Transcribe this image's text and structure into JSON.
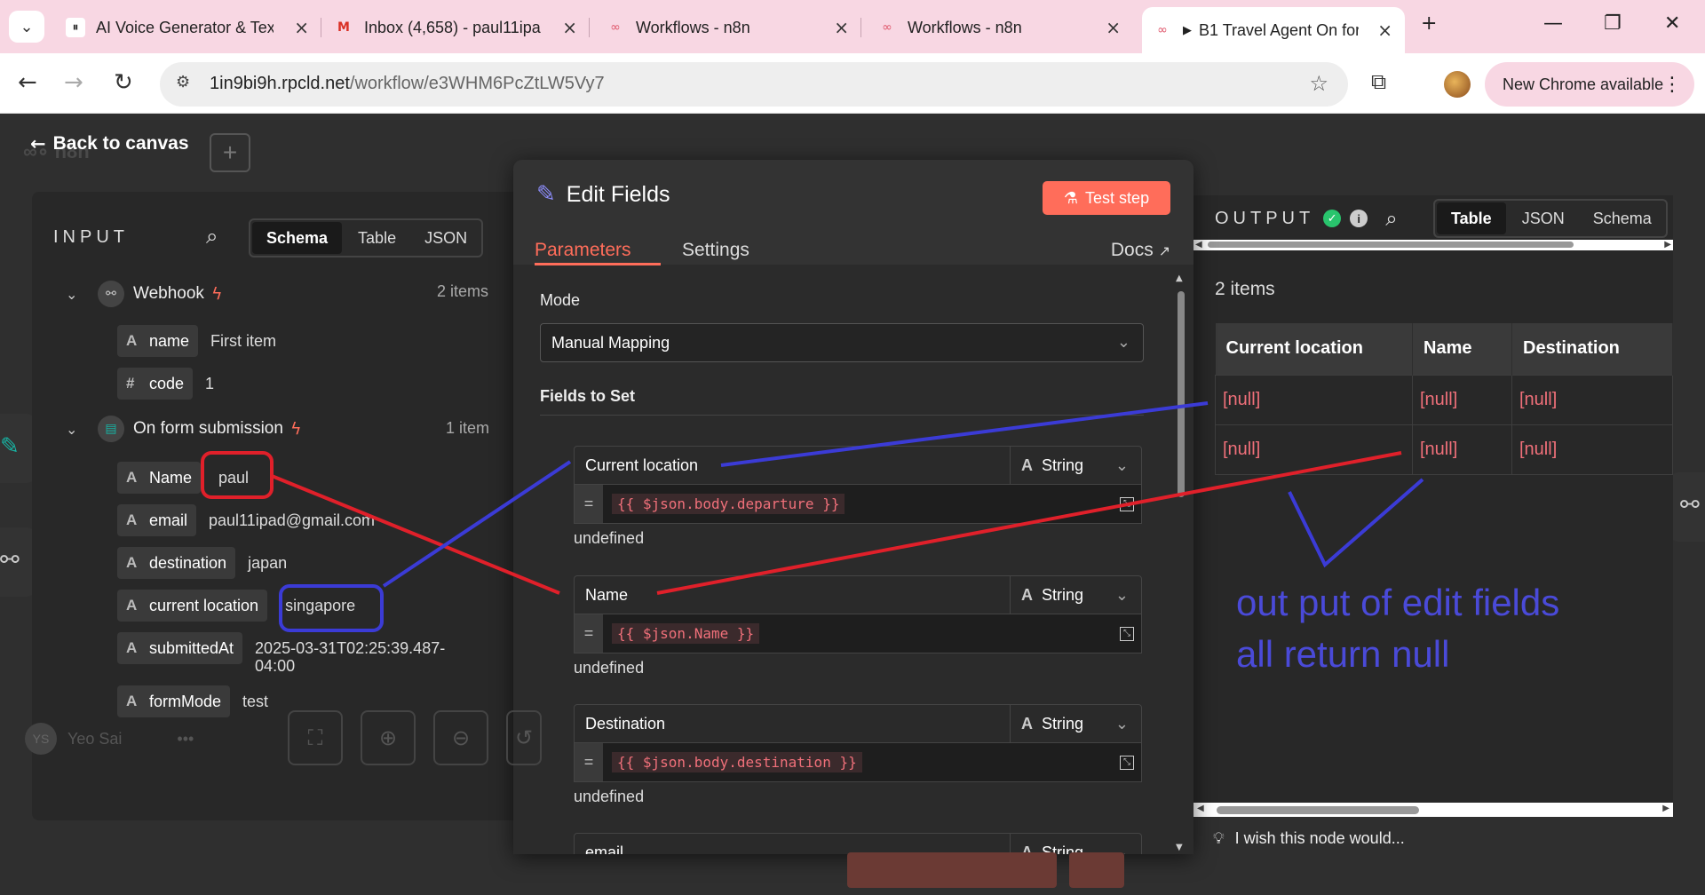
{
  "browser": {
    "tabs": [
      {
        "title": "AI Voice Generator & Text",
        "icon": "pause-icon"
      },
      {
        "title": "Inbox (4,658) - paul11ipa",
        "icon": "gmail-icon"
      },
      {
        "title": "Workflows - n8n",
        "icon": "n8n-icon"
      },
      {
        "title": "Workflows - n8n",
        "icon": "n8n-icon"
      },
      {
        "title": "B1 Travel Agent On for",
        "icon": "n8n-icon"
      }
    ],
    "url_host": "1in9bi9h.rpcld.net",
    "url_path": "/workflow/e3WHM6PcZtLW5Vy7",
    "new_chrome": "New Chrome available"
  },
  "app": {
    "back_to_canvas": "Back to canvas",
    "logo_text": "n8n",
    "user_initials": "YS",
    "user_name": "Yeo Sai"
  },
  "input": {
    "label": "INPUT",
    "view_tabs": [
      "Schema",
      "Table",
      "JSON"
    ],
    "active_view": "Schema",
    "nodes": [
      {
        "name": "Webhook",
        "count": "2 items",
        "fields": [
          {
            "type": "A",
            "key": "name",
            "value": "First item"
          },
          {
            "type": "#",
            "key": "code",
            "value": "1"
          }
        ]
      },
      {
        "name": "On form submission",
        "count": "1 item",
        "fields": [
          {
            "type": "A",
            "key": "Name",
            "value": "paul"
          },
          {
            "type": "A",
            "key": "email",
            "value": "paul11ipad@gmail.com"
          },
          {
            "type": "A",
            "key": "destination",
            "value": "japan"
          },
          {
            "type": "A",
            "key": "current location",
            "value": "singapore"
          },
          {
            "type": "A",
            "key": "submittedAt",
            "value": "2025-03-31T02:25:39.487-",
            "value2": "04:00"
          },
          {
            "type": "A",
            "key": "formMode",
            "value": "test"
          }
        ]
      }
    ]
  },
  "edit": {
    "title": "Edit Fields",
    "test_step": "Test step",
    "tabs": [
      "Parameters",
      "Settings"
    ],
    "active_tab": "Parameters",
    "docs": "Docs",
    "mode_label": "Mode",
    "mode_value": "Manual Mapping",
    "fields_label": "Fields to Set",
    "fields": [
      {
        "name": "Current location",
        "type": "String",
        "expr": "{{ $json.body.departure }}",
        "hint": "undefined"
      },
      {
        "name": "Name",
        "type": "String",
        "expr": "{{ $json.Name }}",
        "hint": "undefined"
      },
      {
        "name": "Destination",
        "type": "String",
        "expr": "{{ $json.body.destination }}",
        "hint": "undefined"
      },
      {
        "name": "email",
        "type": "String"
      }
    ]
  },
  "output": {
    "label": "OUTPUT",
    "view_tabs": [
      "Table",
      "JSON",
      "Schema"
    ],
    "active_view": "Table",
    "count": "2 items",
    "columns": [
      "Current location",
      "Name",
      "Destination"
    ],
    "rows": [
      [
        "[null]",
        "[null]",
        "[null]"
      ],
      [
        "[null]",
        "[null]",
        "[null]"
      ]
    ],
    "wish": "I wish this node would..."
  },
  "annotation": {
    "text": "out put of edit fields\nall return null",
    "color_blue": "#3b3bd6",
    "color_red": "#e0202a"
  },
  "colors": {
    "accent": "#ff6d5a",
    "null_value": "#f0707a",
    "success": "#29c46d",
    "tabstrip": "#f8d7e3"
  }
}
